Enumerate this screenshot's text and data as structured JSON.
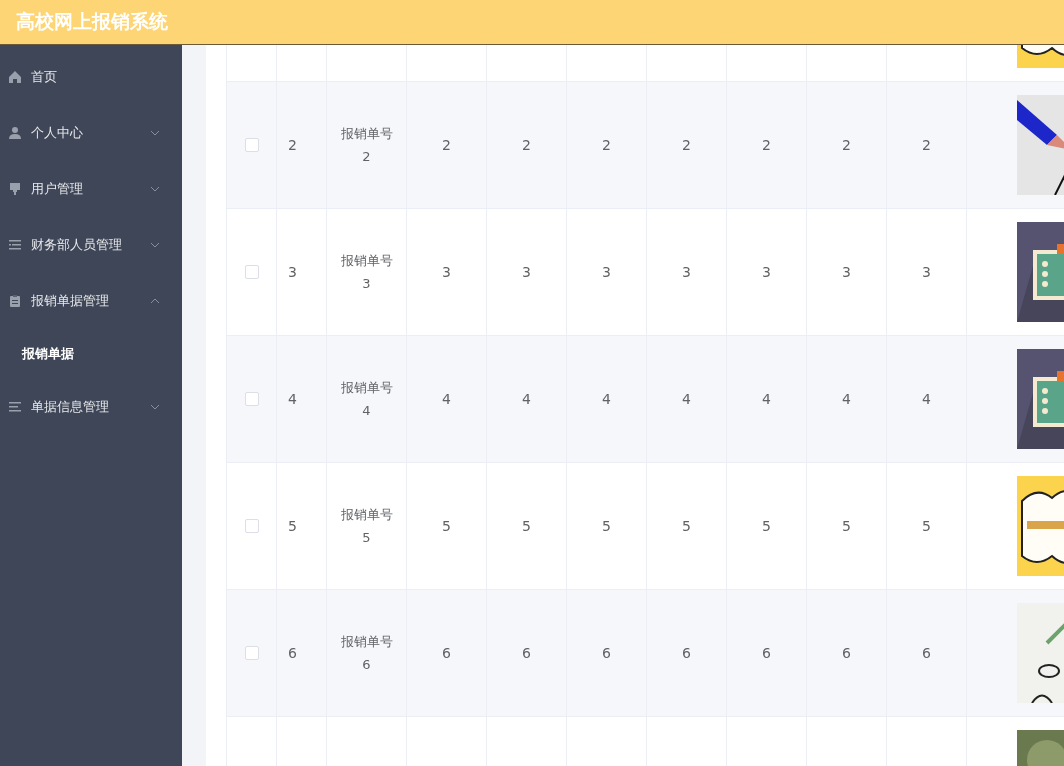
{
  "header": {
    "title": "高校网上报销系统"
  },
  "sidebar": {
    "items": [
      {
        "label": "首页"
      },
      {
        "label": "个人中心",
        "expanded": false
      },
      {
        "label": "用户管理",
        "expanded": false
      },
      {
        "label": "财务部人员管理",
        "expanded": false
      },
      {
        "label": "报销单据管理",
        "expanded": true,
        "children": [
          {
            "label": "报销单据"
          }
        ]
      },
      {
        "label": "单据信息管理",
        "expanded": false
      }
    ]
  },
  "table": {
    "rows": [
      {
        "kind": "partial"
      },
      {
        "kind": "full",
        "checked": false,
        "index": "2",
        "name": "报销单号2",
        "values": [
          "2",
          "2",
          "2",
          "2",
          "2",
          "2",
          "2"
        ]
      },
      {
        "kind": "full",
        "checked": false,
        "index": "3",
        "name": "报销单号3",
        "values": [
          "3",
          "3",
          "3",
          "3",
          "3",
          "3",
          "3"
        ]
      },
      {
        "kind": "full",
        "checked": false,
        "index": "4",
        "name": "报销单号4",
        "values": [
          "4",
          "4",
          "4",
          "4",
          "4",
          "4",
          "4"
        ]
      },
      {
        "kind": "full",
        "checked": false,
        "index": "5",
        "name": "报销单号5",
        "values": [
          "5",
          "5",
          "5",
          "5",
          "5",
          "5",
          "5"
        ]
      },
      {
        "kind": "full",
        "checked": false,
        "index": "6",
        "name": "报销单号6",
        "values": [
          "6",
          "6",
          "6",
          "6",
          "6",
          "6",
          "6"
        ]
      },
      {
        "kind": "partial"
      }
    ]
  }
}
